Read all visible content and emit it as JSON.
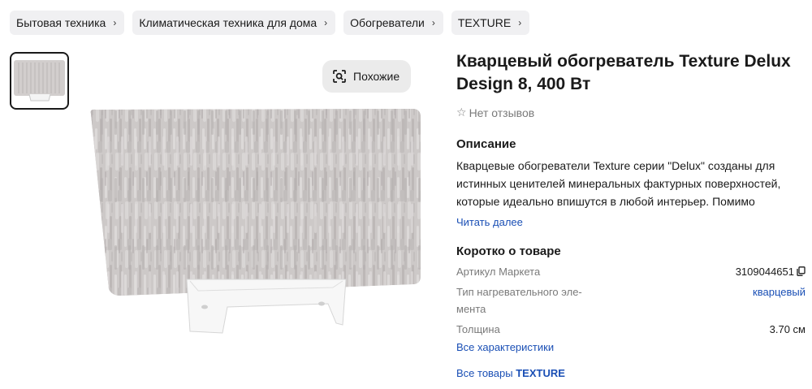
{
  "breadcrumbs": [
    {
      "label": "Бытовая техника"
    },
    {
      "label": "Климатическая техника для дома"
    },
    {
      "label": "Обогреватели"
    },
    {
      "label": "TEXTURE"
    }
  ],
  "gallery": {
    "similar_label": "Похожие"
  },
  "product": {
    "title": "Кварцевый обогреватель Texture Delux Design 8, 400 Вт",
    "reviews": "Нет отзывов"
  },
  "description": {
    "heading": "Описание",
    "text": "Кварцевые обогреватели Texture серии \"Delux\" созданы для истинных ценителей минеральных фактурных поверхностей, которые идеально впишутся в любой интерьер. Помимо",
    "read_more": "Читать далее"
  },
  "short": {
    "heading": "Коротко о товаре",
    "specs": [
      {
        "key": "Артикул Маркета",
        "value": "3109044651"
      },
      {
        "key": "Тип нагревательного эле-\nмента",
        "value": "кварцевый"
      },
      {
        "key": "Толщина",
        "value": "3.70 см"
      }
    ],
    "all_specs": "Все характеристики",
    "all_goods_prefix": "Все товары ",
    "all_goods_brand": "TEXTURE"
  },
  "colors": {
    "link": "#1a4fb5",
    "crumb_bg": "#f0f0f2",
    "panel": "#cfcbca",
    "muted": "#7a7a7a"
  }
}
